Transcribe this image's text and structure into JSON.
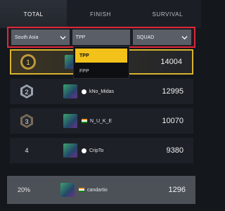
{
  "tabs": [
    {
      "label": "TOTAL",
      "active": true
    },
    {
      "label": "FINISH",
      "active": false
    },
    {
      "label": "SURVIVAL",
      "active": false
    }
  ],
  "filters": {
    "region": "South Asia",
    "perspective": "TPP",
    "team_mode": "SQUAD"
  },
  "perspective_menu": {
    "options": [
      "TPP",
      "FPP"
    ],
    "selected": "TPP"
  },
  "leaderboard": [
    {
      "rank": "1",
      "name": "",
      "score": "14004",
      "badge": "gold-rank-1-icon"
    },
    {
      "rank": "2",
      "name": "kNo_Midas",
      "score": "12995",
      "badge": "silver-rank-2-icon"
    },
    {
      "rank": "3",
      "name": "N_U_K_E",
      "score": "10070",
      "badge": "bronze-rank-3-icon"
    },
    {
      "rank": "4",
      "name": "CripTo",
      "score": "9380",
      "badge": ""
    }
  ],
  "player": {
    "rank": "20%",
    "name": "candartio",
    "score": "1296"
  },
  "colors": {
    "highlight_border": "#e0263a",
    "gold": "#d9b32c",
    "menu_selected": "#f2c21a"
  }
}
